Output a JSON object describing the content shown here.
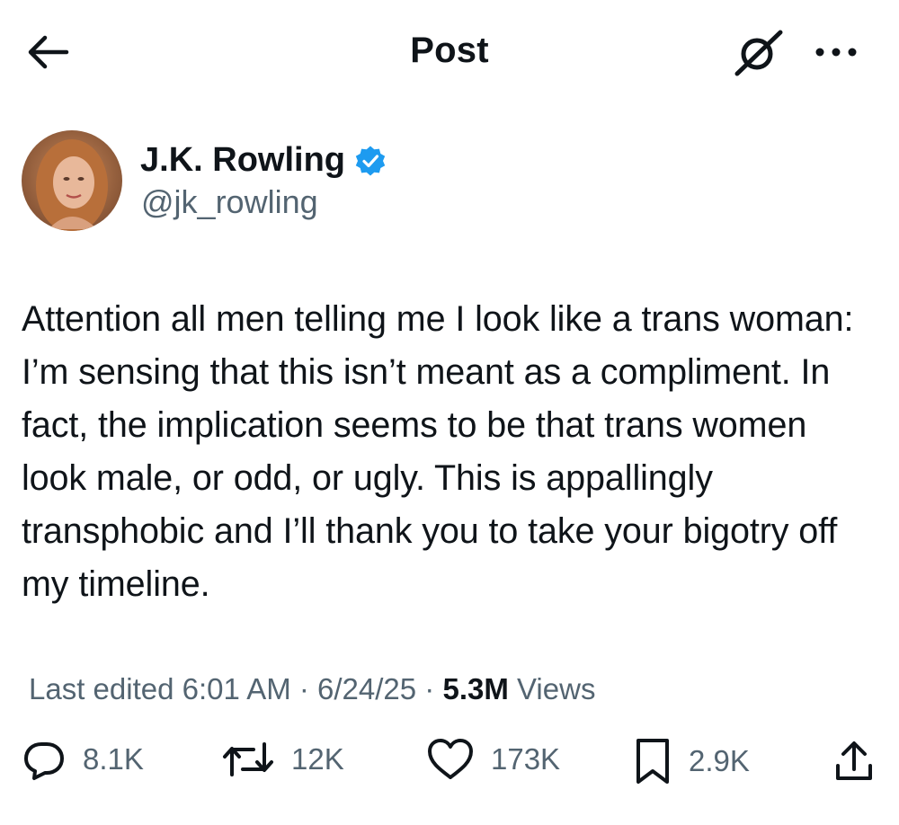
{
  "header": {
    "title": "Post"
  },
  "author": {
    "name": "J.K. Rowling",
    "handle": "@jk_rowling",
    "verified_color": "#1d9bf0"
  },
  "post": {
    "text": "Attention all men telling me I look like a trans woman: I’m sensing that this isn’t meant as a compliment. In fact, the implication seems to be that trans women look male, or odd, or ugly. This is appallingly transphobic and I’ll thank you to take your bigotry off my timeline.",
    "edited_label": "Last edited 6:01 AM · 6/24/25 ·",
    "views_count": "5.3M",
    "views_label": "Views"
  },
  "actions": {
    "replies": "8.1K",
    "reposts": "12K",
    "likes": "173K",
    "bookmarks": "2.9K"
  },
  "icons": [
    "back-arrow-icon",
    "grok-icon",
    "more-icon",
    "verified-badge-icon",
    "reply-icon",
    "repost-icon",
    "like-icon",
    "bookmark-icon",
    "share-icon"
  ]
}
